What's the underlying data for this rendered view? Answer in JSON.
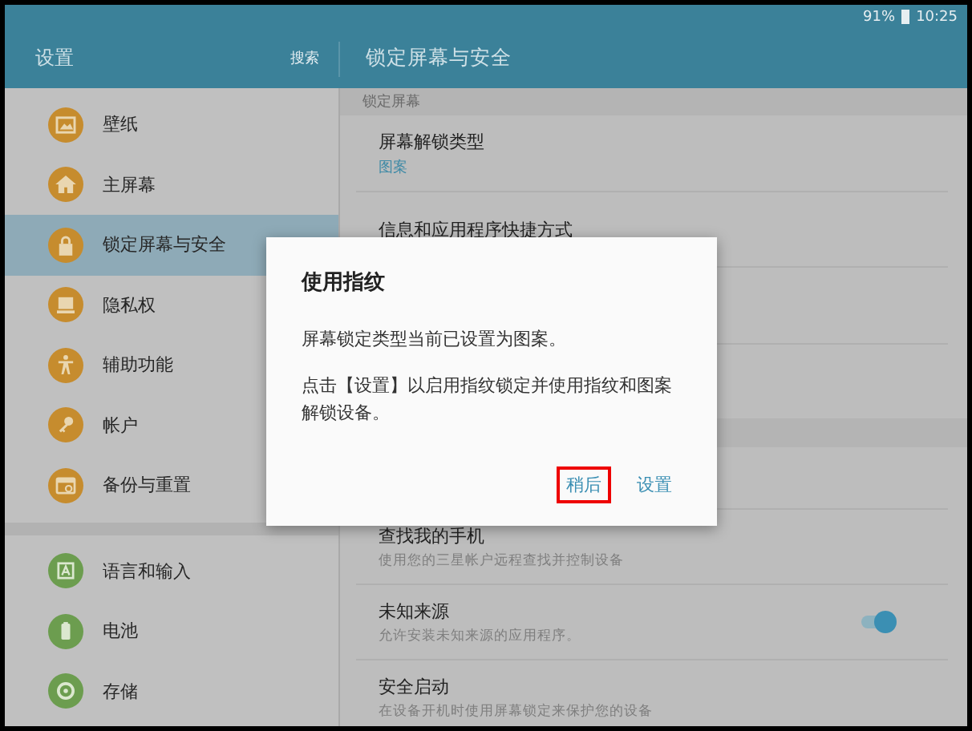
{
  "status_bar": {
    "battery": "91%",
    "time": "10:25"
  },
  "header": {
    "title": "设置",
    "search": "搜索",
    "page_title": "锁定屏幕与安全"
  },
  "sidebar": {
    "groups": [
      {
        "items": [
          {
            "label": "壁纸",
            "selected": false
          },
          {
            "label": "主屏幕",
            "selected": false
          },
          {
            "label": "锁定屏幕与安全",
            "selected": true
          },
          {
            "label": "隐私权",
            "selected": false
          },
          {
            "label": "辅助功能",
            "selected": false
          },
          {
            "label": "帐户",
            "selected": false
          },
          {
            "label": "备份与重置",
            "selected": false
          }
        ]
      },
      {
        "items": [
          {
            "label": "语言和输入",
            "selected": false
          },
          {
            "label": "电池",
            "selected": false
          },
          {
            "label": "存储",
            "selected": false
          }
        ]
      }
    ]
  },
  "detail": {
    "sections": [
      {
        "title": "锁定屏幕",
        "rows": [
          {
            "title": "屏幕解锁类型",
            "value": "图案"
          },
          {
            "title": "信息和应用程序快捷方式"
          }
        ]
      },
      {
        "rows": [
          {
            "title": "查找我的手机",
            "subtitle": "使用您的三星帐户远程查找并控制设备"
          },
          {
            "title": "未知来源",
            "subtitle": "允许安装未知来源的应用程序。",
            "kind": "toggle",
            "on": true
          },
          {
            "title": "安全启动",
            "subtitle": "在设备开机时使用屏幕锁定来保护您的设备"
          }
        ]
      }
    ]
  },
  "dialog": {
    "title": "使用指纹",
    "paragraphs": [
      "屏幕锁定类型当前已设置为图案。",
      "点击【设置】以启用指纹锁定并使用指纹和图案解锁设备。"
    ],
    "buttons": [
      {
        "label": "稍后",
        "highlighted": true
      },
      {
        "label": "设置",
        "highlighted": false
      }
    ]
  }
}
